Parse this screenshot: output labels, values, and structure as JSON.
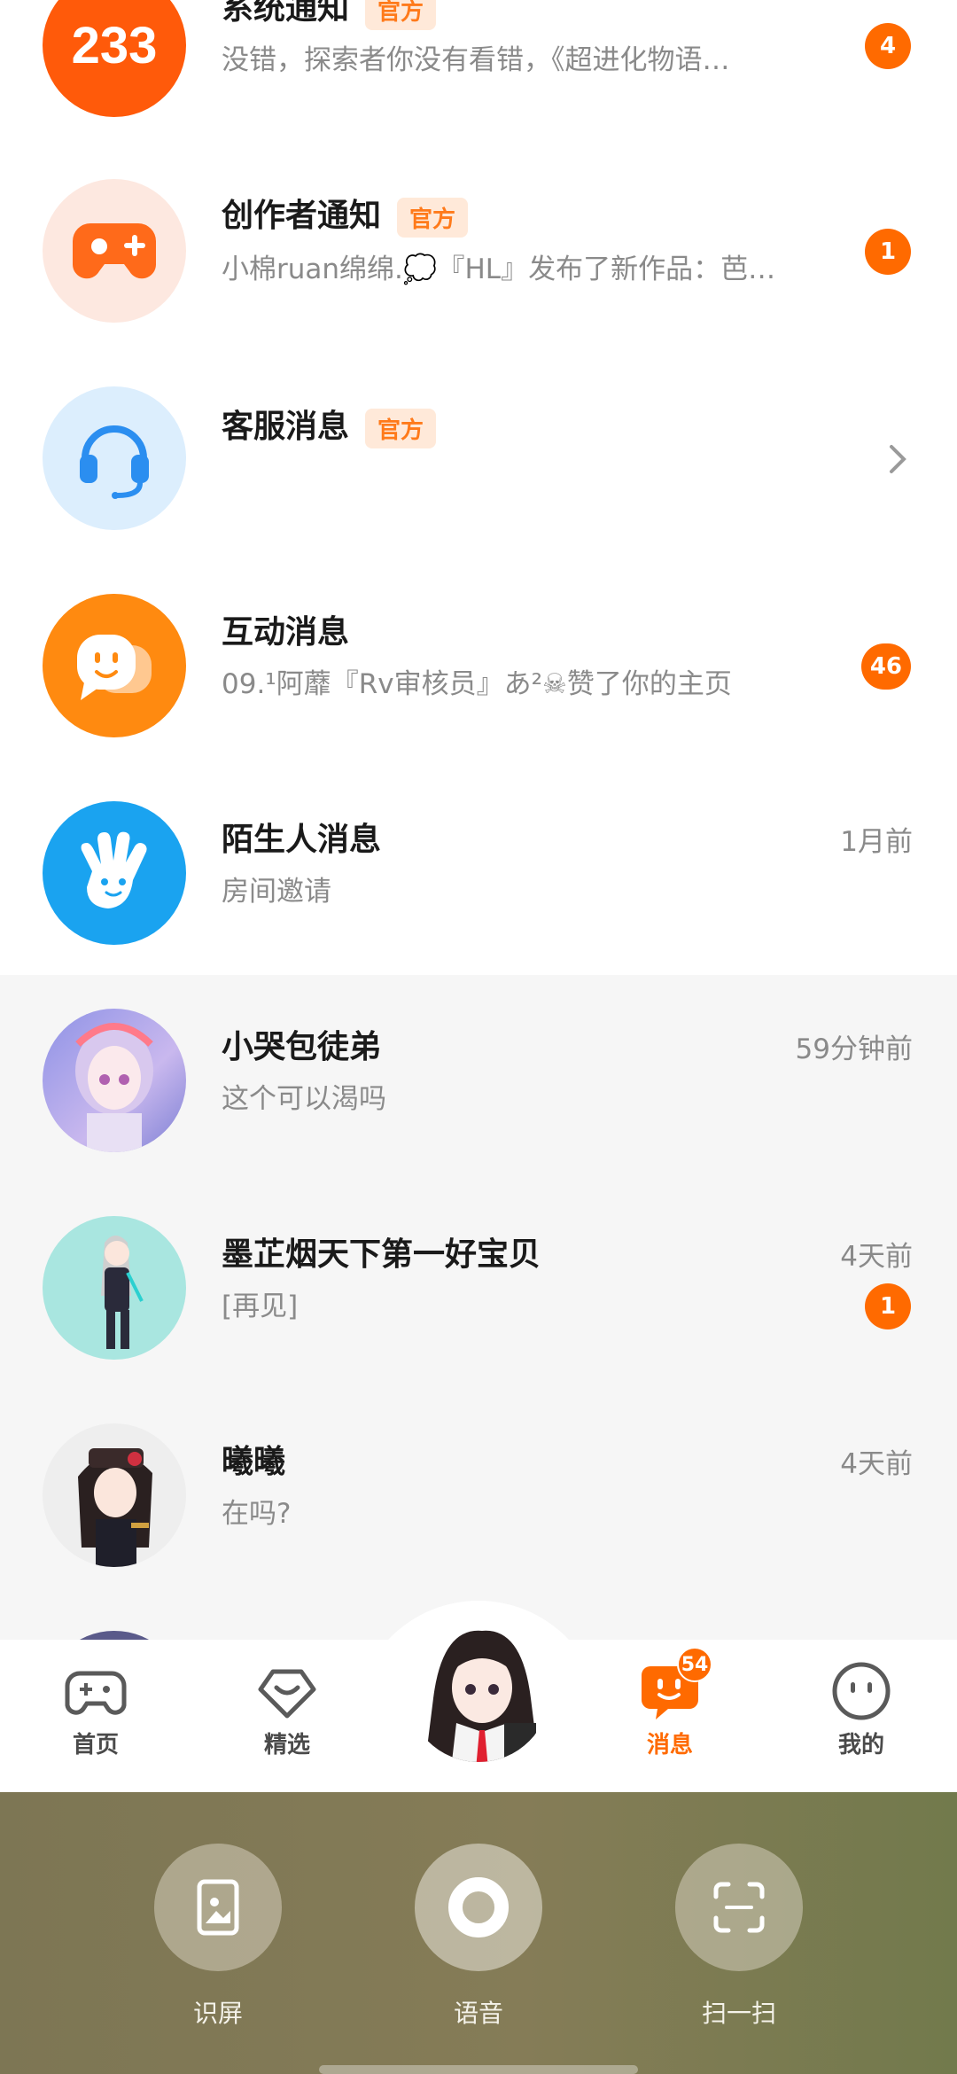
{
  "conversations": [
    {
      "title": "系统通知",
      "tag": "官方",
      "preview": "没错，探索者你没有看错，《超进化物语…",
      "time": "",
      "badge": "4",
      "icon": "233-logo-icon"
    },
    {
      "title": "创作者通知",
      "tag": "官方",
      "preview": "小棉ruan绵绵.💭『HL』发布了新作品：芭…",
      "time": "",
      "badge": "1",
      "icon": "gamepad-plus-icon"
    },
    {
      "title": "客服消息",
      "tag": "官方",
      "preview": "",
      "time": "",
      "badge": "",
      "icon": "headset-icon"
    },
    {
      "title": "互动消息",
      "tag": "",
      "preview": "09.¹阿蘼『Rv审核员』あ²☠赞了你的主页",
      "time": "",
      "badge": "46",
      "icon": "chat-bubble-smile-icon"
    },
    {
      "title": "陌生人消息",
      "tag": "",
      "preview": "房间邀请",
      "time": "1月前",
      "badge": "",
      "icon": "hand-wave-icon"
    },
    {
      "title": "小哭包徒弟",
      "tag": "",
      "preview": "这个可以渴吗",
      "time": "59分钟前",
      "badge": "",
      "icon": "user-avatar"
    },
    {
      "title": "墨芷烟天下第一好宝贝",
      "tag": "",
      "preview": "[再见]",
      "time": "4天前",
      "badge": "1",
      "icon": "user-avatar"
    },
    {
      "title": "曦曦",
      "tag": "",
      "preview": "在吗?",
      "time": "4天前",
      "badge": "",
      "icon": "user-avatar"
    }
  ],
  "nav": {
    "home": "首页",
    "featured": "精选",
    "messages": "消息",
    "messages_badge": "54",
    "me": "我的"
  },
  "assistant": {
    "screen": "识屏",
    "voice": "语音",
    "scan": "扫一扫"
  },
  "colors": {
    "accent": "#ff6a00",
    "tag_bg": "#ffe9d9",
    "list_gray": "#f6f6f6",
    "assistant_bg": "#7d7654"
  }
}
